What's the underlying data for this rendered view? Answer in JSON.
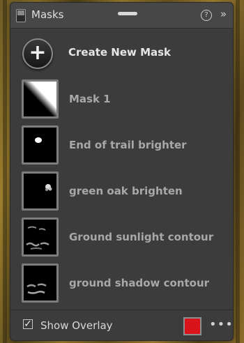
{
  "panel": {
    "title": "Masks",
    "help_icon": "?",
    "collapse_icon": "»"
  },
  "create": {
    "icon": "+",
    "label": "Create New Mask"
  },
  "masks": [
    {
      "label": "Mask 1",
      "icon": "gradient-thumbnail"
    },
    {
      "label": "End of trail brighter",
      "icon": "spot-thumbnail"
    },
    {
      "label": "green oak brighten",
      "icon": "spot-thumbnail"
    },
    {
      "label": "Ground sunlight contour",
      "icon": "contour-thumbnail"
    },
    {
      "label": "ground shadow contour",
      "icon": "contour-thumbnail"
    }
  ],
  "footer": {
    "checkbox_mark": "✓",
    "show_overlay_label": "Show Overlay",
    "overlay_checked": true,
    "overlay_color": "#d9141c",
    "more_icon": "•••"
  }
}
